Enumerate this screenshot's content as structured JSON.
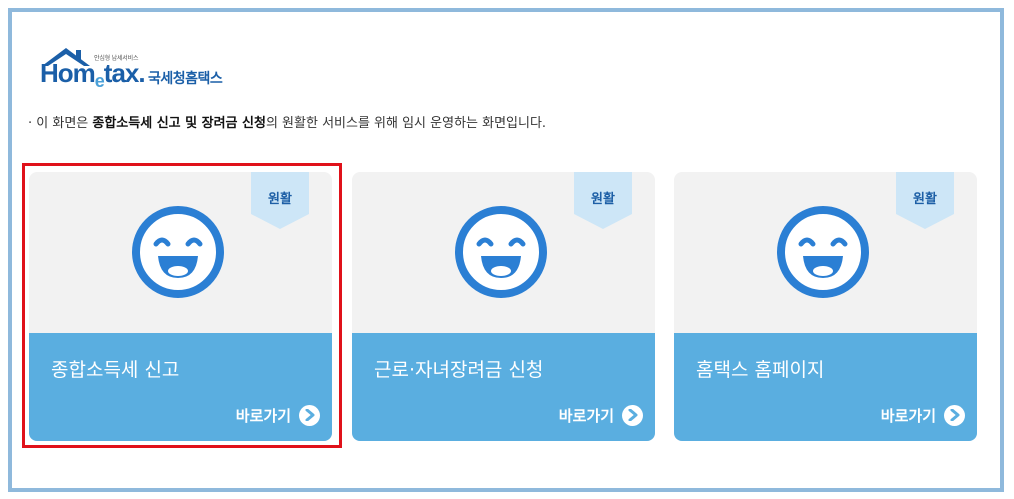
{
  "logo": {
    "tagline": "안심형 납세서비스",
    "brand_home": "Hom",
    "brand_e": "e",
    "brand_tax": "tax.",
    "korean": "국세청홈택스"
  },
  "notice": {
    "prefix": "· 이 화면은 ",
    "bold": "종합소득세 신고 및 장려금 신청",
    "suffix": "의 원활한 서비스를 위해 임시 운영하는 화면입니다."
  },
  "cards": [
    {
      "status": "원활",
      "title": "종합소득세 신고",
      "link": "바로가기"
    },
    {
      "status": "원활",
      "title": "근로·자녀장려금 신청",
      "link": "바로가기"
    },
    {
      "status": "원활",
      "title": "홈택스 홈페이지",
      "link": "바로가기"
    }
  ],
  "colors": {
    "frame_border": "#8fb9dc",
    "card_panel": "#5aaee0",
    "face_blue": "#2b7fd4",
    "ribbon": "#cde6f7",
    "highlight": "#e0111a"
  }
}
